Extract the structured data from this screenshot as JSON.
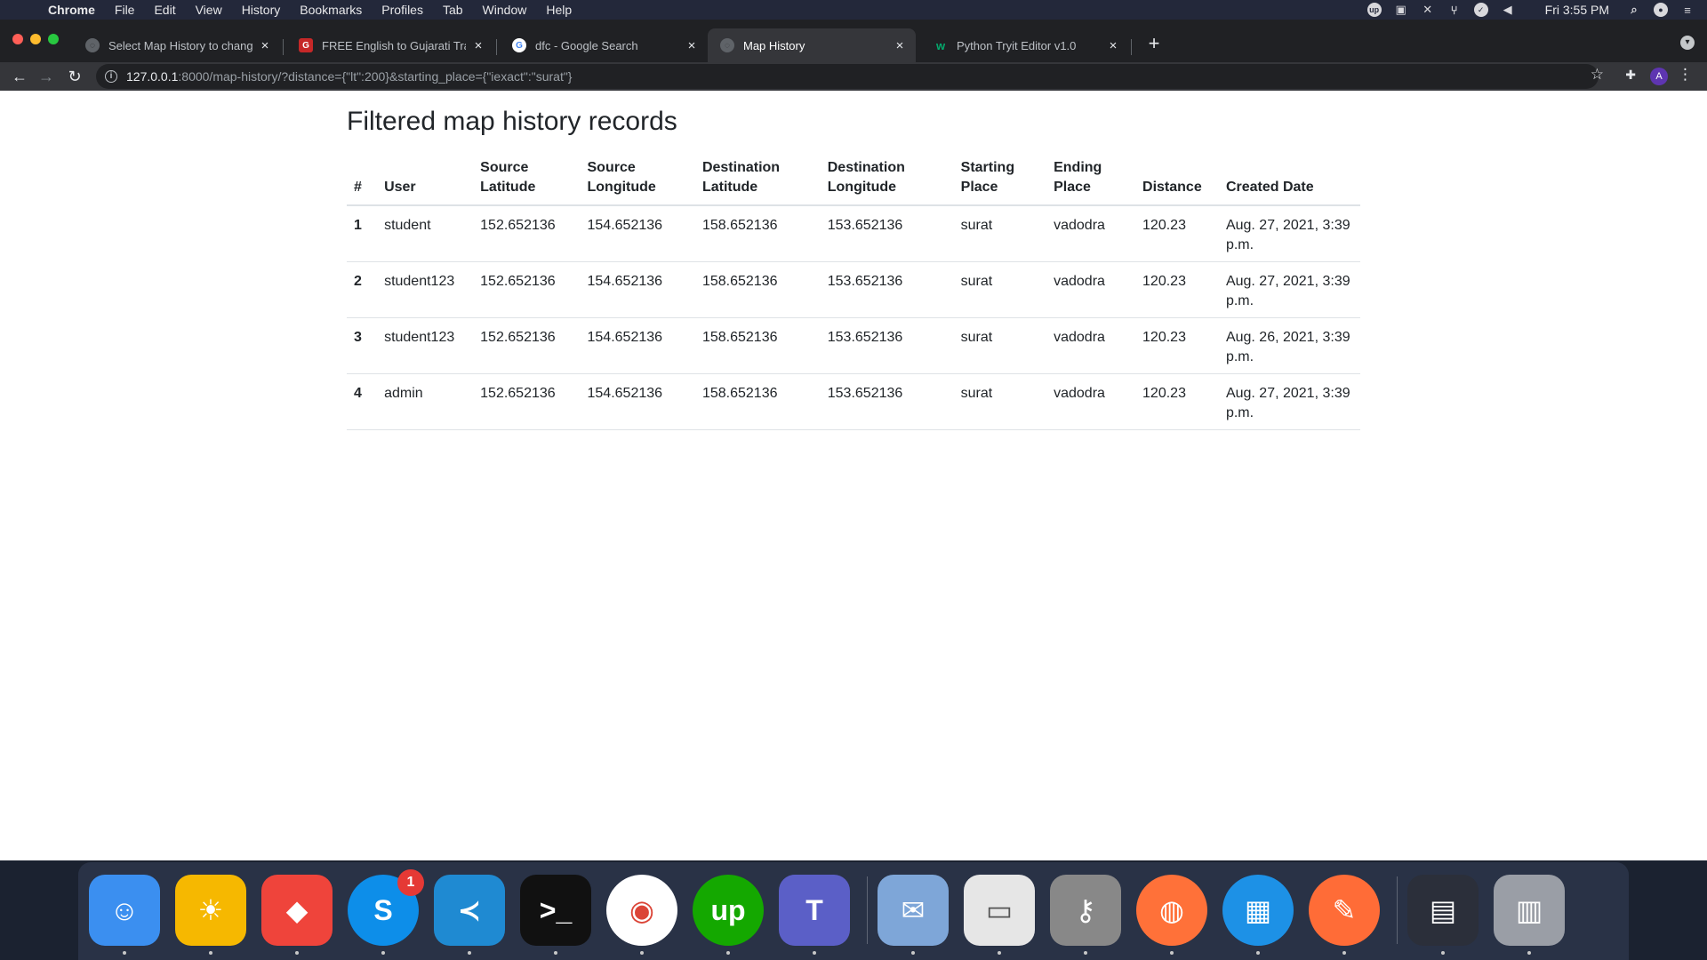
{
  "menubar": {
    "apple": "",
    "items": [
      "Chrome",
      "File",
      "Edit",
      "View",
      "History",
      "Bookmarks",
      "Profiles",
      "Tab",
      "Window",
      "Help"
    ],
    "clock": "Fri 3:55 PM",
    "tray_icons": [
      "upwork-icon",
      "docker-icon",
      "network-icon",
      "git-icon",
      "checkmark-icon",
      "volume-icon",
      "search-icon",
      "siri-icon",
      "control-center-icon"
    ]
  },
  "browser": {
    "tabs": [
      {
        "title": "Select Map History to change | Django site admin",
        "favicon": "globe-icon",
        "active": false
      },
      {
        "title": "FREE English to Gujarati Translation",
        "favicon": "translate-icon",
        "active": false
      },
      {
        "title": "dfc - Google Search",
        "favicon": "google-icon",
        "active": false
      },
      {
        "title": "Map History",
        "favicon": "globe-icon",
        "active": true
      },
      {
        "title": "Python Tryit Editor v1.0",
        "favicon": "w3schools-icon",
        "active": false
      }
    ],
    "new_tab_label": "+",
    "close_label": "×",
    "url_host": "127.0.0.1",
    "url_rest": ":8000/map-history/?distance={\"lt\":200}&starting_place={\"iexact\":\"surat\"}",
    "profile_initial": "A"
  },
  "page": {
    "title": "Filtered map history records",
    "columns": [
      [
        "#"
      ],
      [
        "User"
      ],
      [
        "Source",
        "Latitude"
      ],
      [
        "Source",
        "Longitude"
      ],
      [
        "Destination",
        "Latitude"
      ],
      [
        "Destination",
        "Longitude"
      ],
      [
        "Starting",
        "Place"
      ],
      [
        "Ending",
        "Place"
      ],
      [
        "Distance"
      ],
      [
        "Created Date"
      ]
    ],
    "rows": [
      [
        "1",
        "student",
        "152.652136",
        "154.652136",
        "158.652136",
        "153.652136",
        "surat",
        "vadodra",
        "120.23",
        "Aug. 27, 2021, 3:39 p.m."
      ],
      [
        "2",
        "student123",
        "152.652136",
        "154.652136",
        "158.652136",
        "153.652136",
        "surat",
        "vadodra",
        "120.23",
        "Aug. 27, 2021, 3:39 p.m."
      ],
      [
        "3",
        "student123",
        "152.652136",
        "154.652136",
        "158.652136",
        "153.652136",
        "surat",
        "vadodra",
        "120.23",
        "Aug. 26, 2021, 3:39 p.m."
      ],
      [
        "4",
        "admin",
        "152.652136",
        "154.652136",
        "158.652136",
        "153.652136",
        "surat",
        "vadodra",
        "120.23",
        "Aug. 27, 2021, 3:39 p.m."
      ]
    ]
  },
  "dock": {
    "apps": [
      {
        "name": "finder-icon",
        "color": "#3b8ff0"
      },
      {
        "name": "sun-icon",
        "color": "#f6b800"
      },
      {
        "name": "anydesk-icon",
        "color": "#ef443b"
      },
      {
        "name": "skype-icon",
        "color": "#0d8ee9",
        "badge": "1"
      },
      {
        "name": "vscode-icon",
        "color": "#1f8ad2"
      },
      {
        "name": "terminal-icon",
        "color": "#111111"
      },
      {
        "name": "chrome-icon",
        "color": "#ffffff"
      },
      {
        "name": "upwork-icon",
        "color": "#14a800"
      },
      {
        "name": "teams-icon",
        "color": "#5b5fc7"
      },
      {
        "name": "mail-icon",
        "color": "#7ea6d8"
      },
      {
        "name": "file-icon",
        "color": "#e6e6e6"
      },
      {
        "name": "keychain-icon",
        "color": "#888888"
      },
      {
        "name": "firefox-icon",
        "color": "#ff7139"
      },
      {
        "name": "docker-icon",
        "color": "#1d91e6"
      },
      {
        "name": "postman-icon",
        "color": "#ff6c37"
      },
      {
        "name": "window-thumbnail-icon",
        "color": "#2b2f3a"
      },
      {
        "name": "trash-icon",
        "color": "#9a9ea6"
      }
    ]
  }
}
